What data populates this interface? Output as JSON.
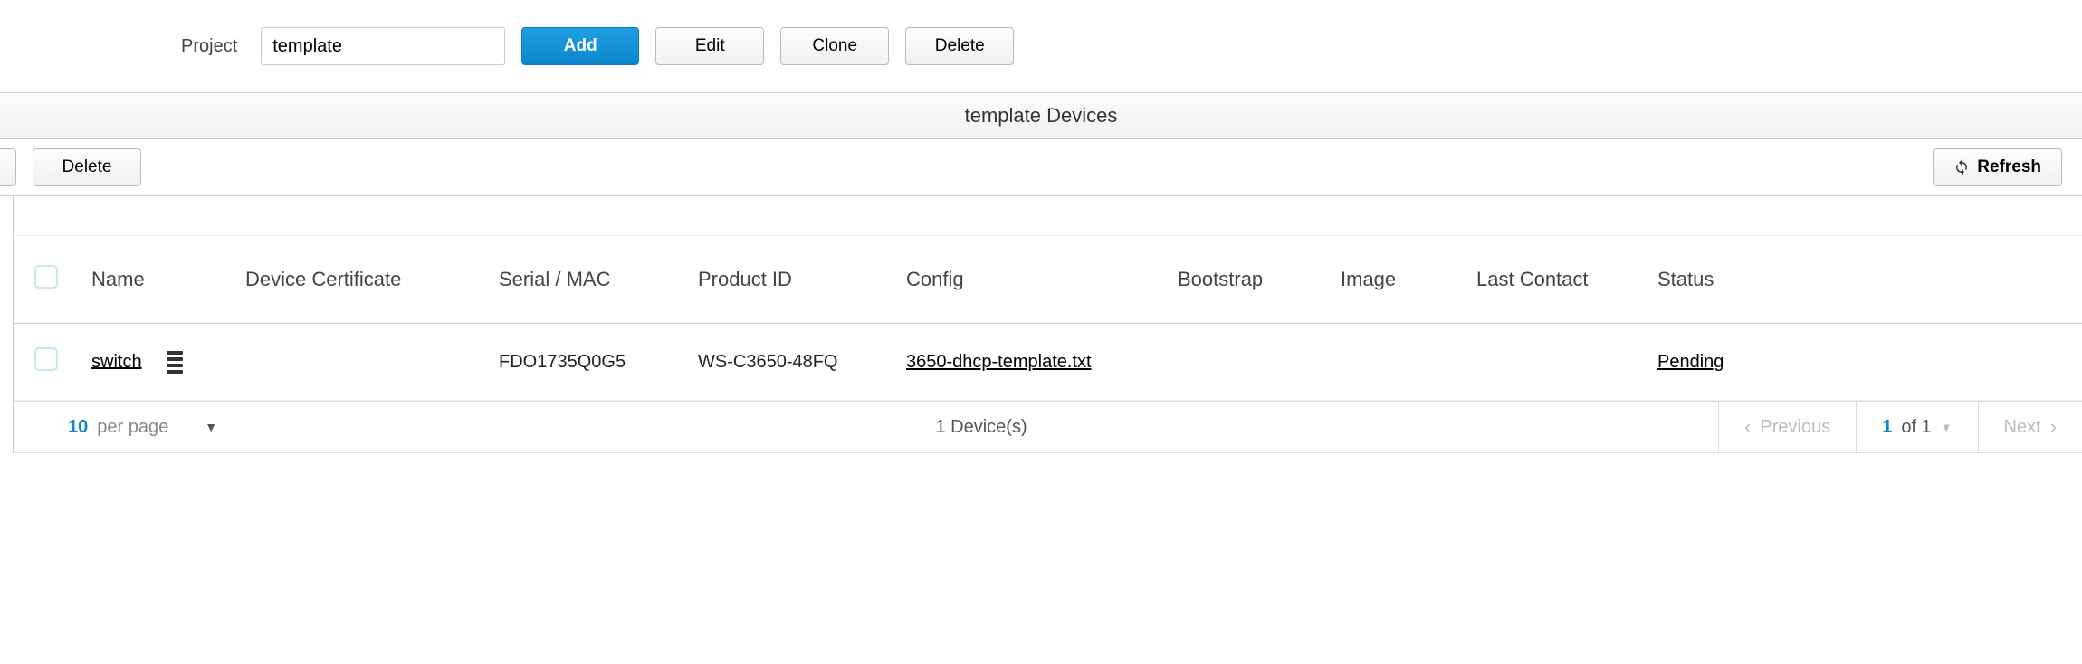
{
  "project": {
    "label": "Project",
    "value": "template"
  },
  "buttons": {
    "add": "Add",
    "edit": "Edit",
    "clone": "Clone",
    "delete": "Delete",
    "refresh": "Refresh"
  },
  "section_title": "template Devices",
  "action_delete": "Delete",
  "table": {
    "headers": {
      "name": "Name",
      "cert": "Device Certificate",
      "serial": "Serial / MAC",
      "product": "Product ID",
      "config": "Config",
      "bootstrap": "Bootstrap",
      "image": "Image",
      "last_contact": "Last Contact",
      "status": "Status"
    },
    "rows": [
      {
        "name": "switch",
        "cert": "",
        "serial": "FDO1735Q0G5",
        "product": "WS-C3650-48FQ",
        "config": "3650-dhcp-template.txt",
        "bootstrap": "",
        "image": "",
        "last_contact": "",
        "status": "Pending"
      }
    ]
  },
  "pager": {
    "per_page": "10",
    "per_page_label": "per page",
    "summary": "1 Device(s)",
    "previous": "Previous",
    "next": "Next",
    "page_cur": "1",
    "page_of": "of 1"
  }
}
